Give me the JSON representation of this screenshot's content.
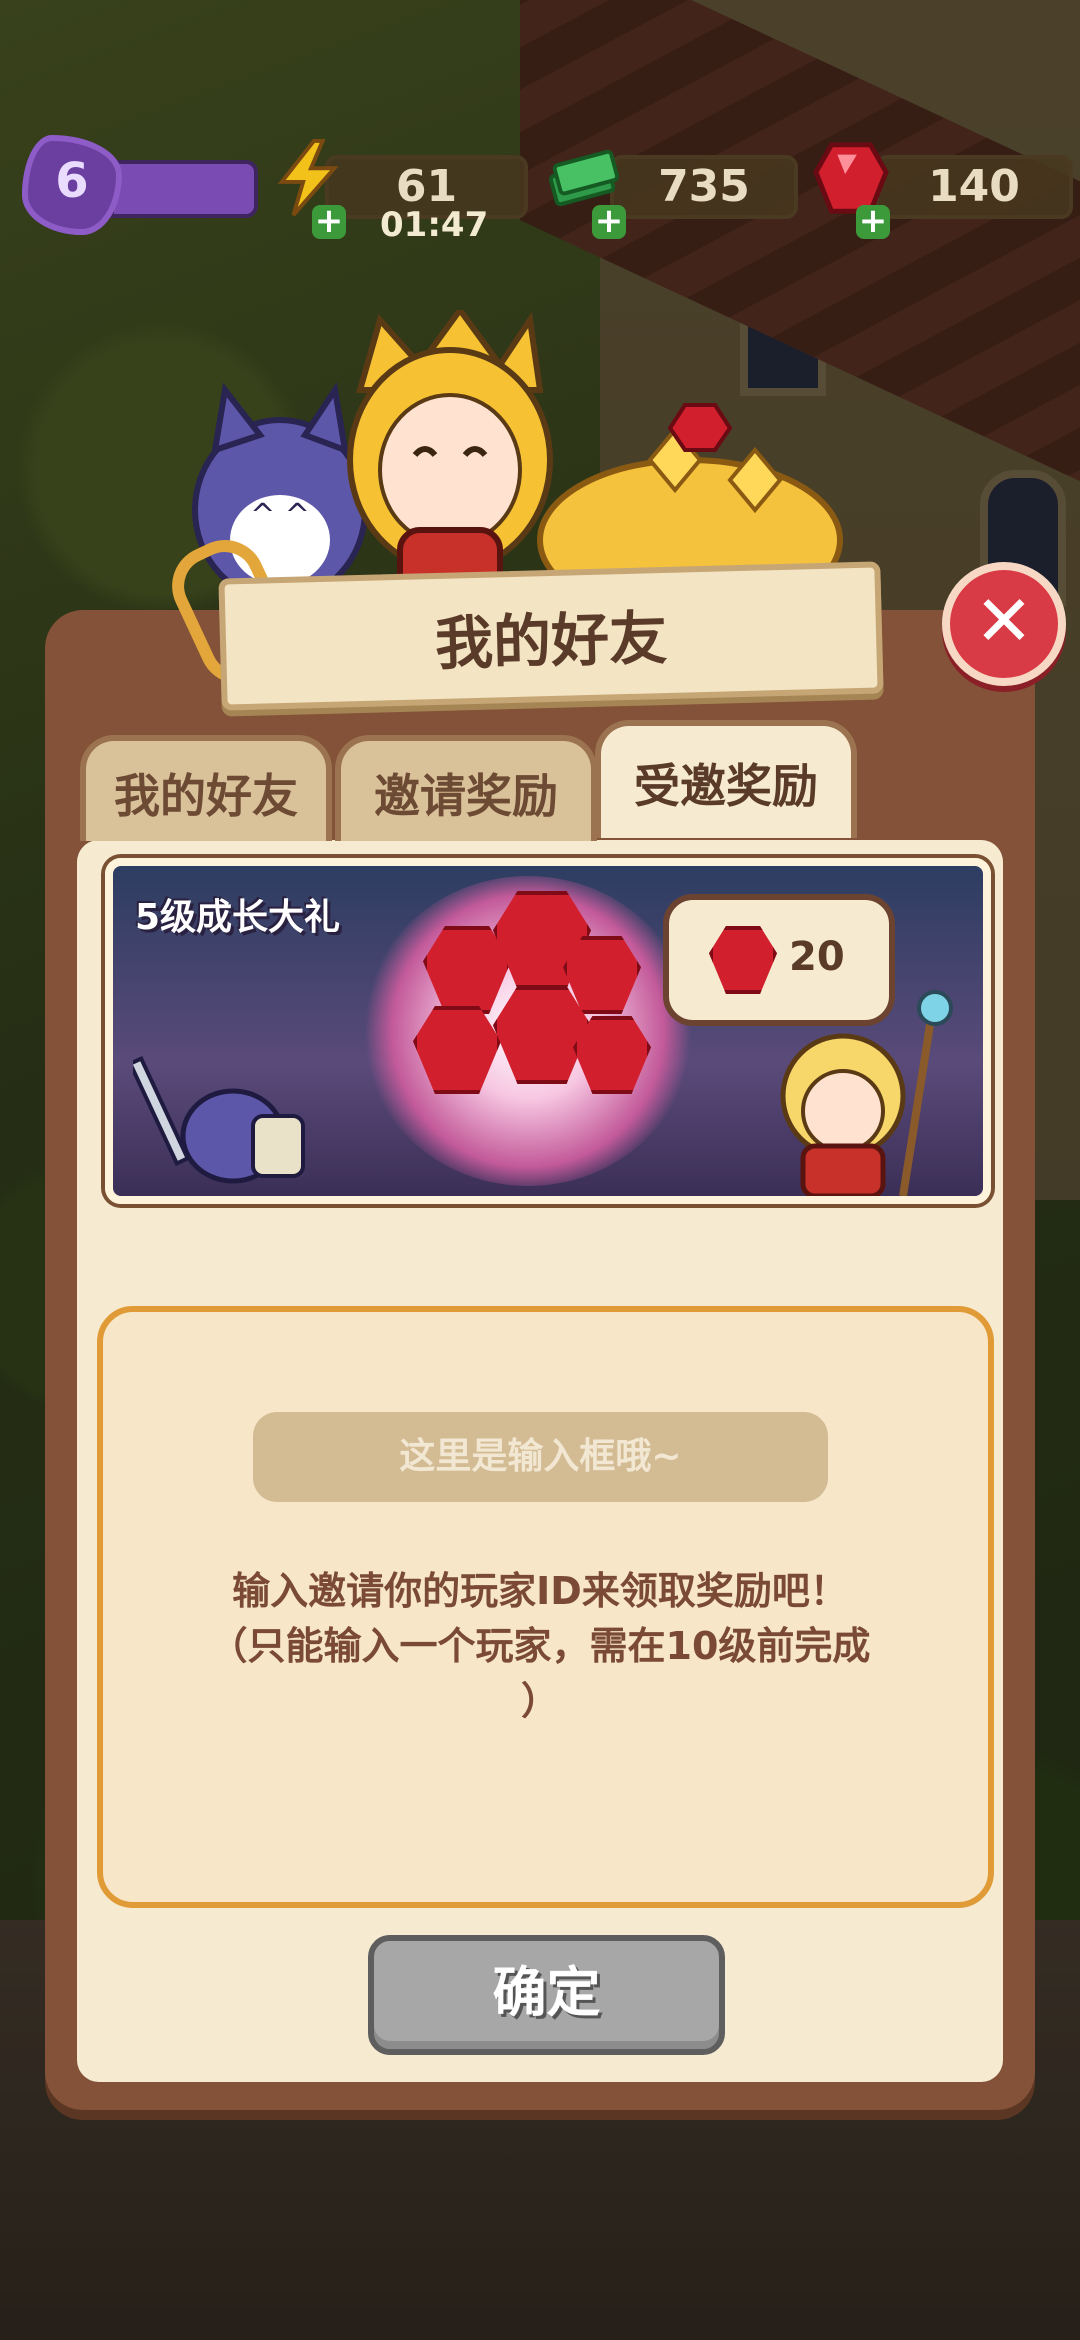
{
  "hud": {
    "level": "6",
    "energy": "61",
    "energy_timer": "01:47",
    "cash": "735",
    "gems": "140"
  },
  "dialog": {
    "title": "我的好友",
    "tabs": [
      {
        "label": "我的好友",
        "active": false
      },
      {
        "label": "邀请奖励",
        "active": false
      },
      {
        "label": "受邀奖励",
        "active": true
      }
    ],
    "banner": {
      "title": "5级成长大礼",
      "reward_amount": "20"
    },
    "input": {
      "placeholder": "这里是输入框哦~"
    },
    "hint_line1": "输入邀请你的玩家ID来领取奖励吧！",
    "hint_line2": "（只能输入一个玩家，需在10级前完成",
    "hint_line3": "）",
    "confirm_label": "确定",
    "close_icon": "close-x",
    "accent_colors": {
      "panel": "#835238",
      "inner": "#f6ebd0",
      "close": "#d93b46",
      "input_border": "#e09b37"
    }
  }
}
